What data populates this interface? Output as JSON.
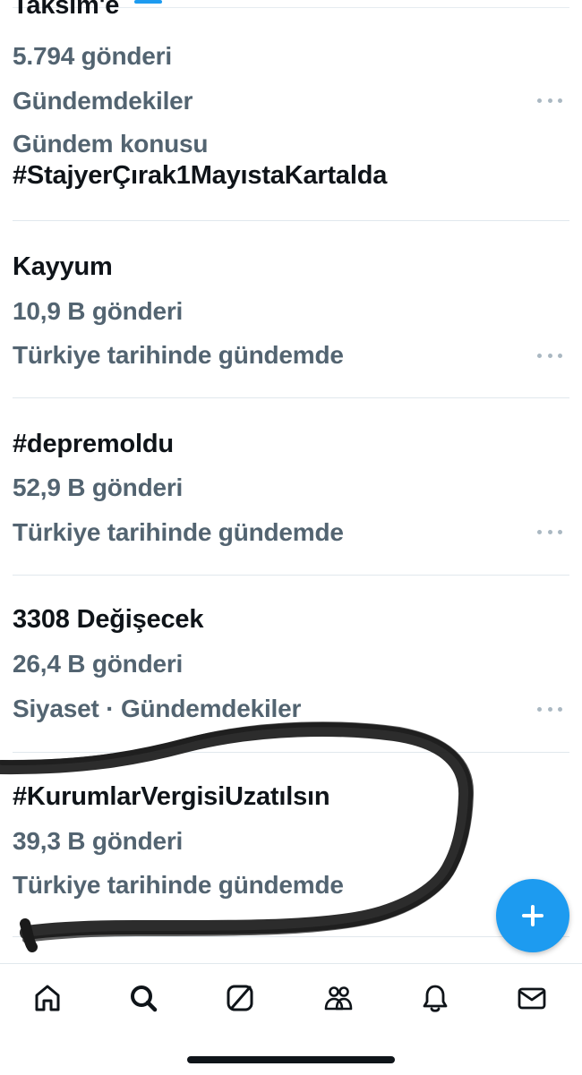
{
  "trends": [
    {
      "title": "Taksim'e",
      "lines": [
        "5.794 gönderi",
        "Gündemdekiler",
        "Gündem konusu"
      ],
      "extra_title": "#StajyerÇırak1MayıstaKartalda"
    },
    {
      "title": "Kayyum",
      "lines": [
        "10,9 B gönderi",
        "Türkiye tarihinde gündemde"
      ]
    },
    {
      "title": "#depremoldu",
      "lines": [
        "52,9 B gönderi",
        "Türkiye tarihinde gündemde"
      ]
    },
    {
      "title": "3308 Değişecek",
      "lines": [
        "26,4 B gönderi",
        "Siyaset · Gündemdekiler"
      ]
    },
    {
      "title": "#KurumlarVergisiUzatılsın",
      "lines": [
        "39,3 B gönderi",
        "Türkiye tarihinde gündemde"
      ]
    }
  ],
  "fab": {
    "icon": "plus-icon"
  },
  "tabbar": {
    "tabs": [
      {
        "name": "home",
        "icon": "home-icon"
      },
      {
        "name": "search",
        "icon": "search-icon"
      },
      {
        "name": "grok",
        "icon": "grok-icon"
      },
      {
        "name": "communities",
        "icon": "communities-icon"
      },
      {
        "name": "notifications",
        "icon": "bell-icon"
      },
      {
        "name": "messages",
        "icon": "mail-icon"
      }
    ]
  },
  "colors": {
    "accent": "#1d9bf0",
    "text_primary": "#0f1419",
    "text_secondary": "#536471",
    "separator": "#e1e8ed",
    "annotation_marker": "#1a1a1a"
  }
}
